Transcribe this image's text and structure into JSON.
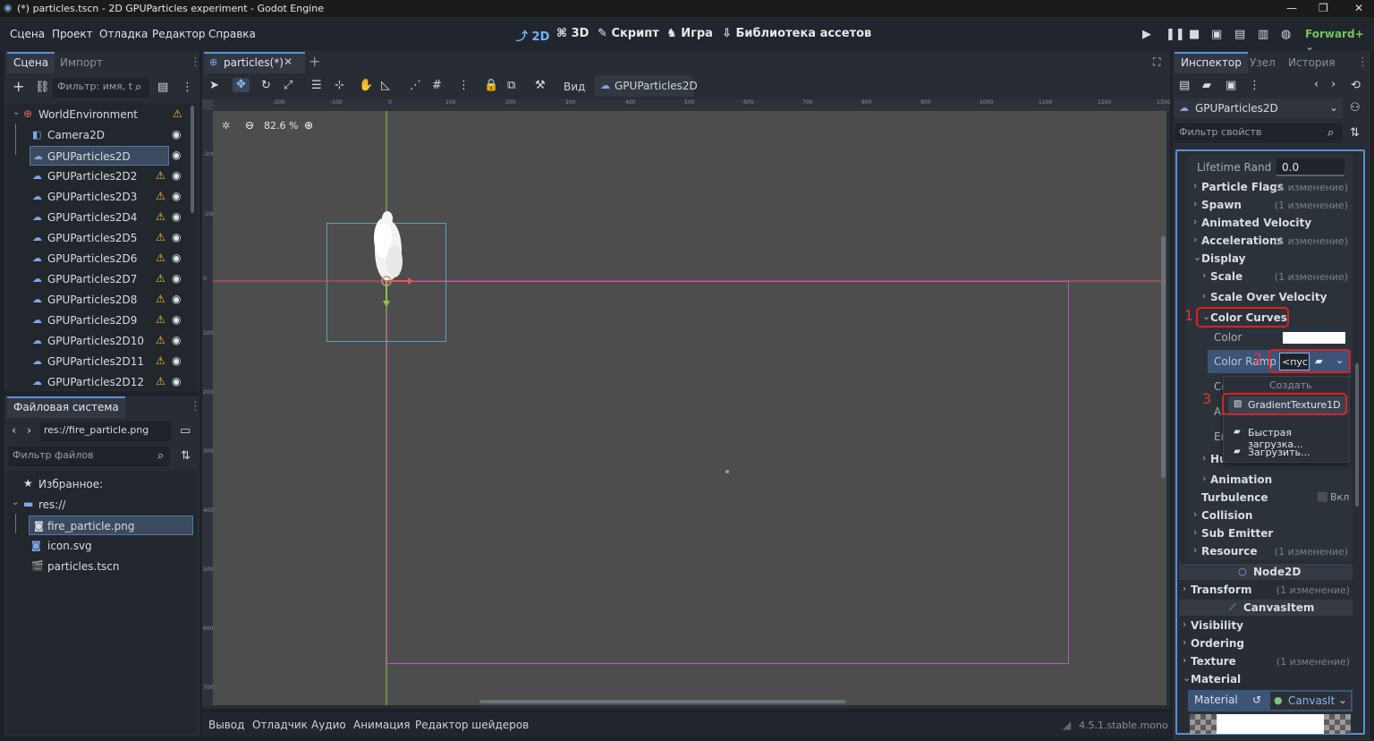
{
  "titlebar": {
    "title": "(*) particles.tscn - 2D GPUParticles experiment - Godot Engine"
  },
  "menu": [
    "Сцена",
    "Проект",
    "Отладка",
    "Редактор",
    "Справка"
  ],
  "workspaces": [
    "2D",
    "3D",
    "Скрипт",
    "Игра",
    "Библиотека ассетов"
  ],
  "renderer": "Forward+",
  "scene_panel": {
    "tabs": [
      "Сцена",
      "Импорт"
    ],
    "filter_placeholder": "Фильтр: имя, t",
    "root": "WorldEnvironment",
    "nodes": [
      "Camera2D",
      "GPUParticles2D",
      "GPUParticles2D2",
      "GPUParticles2D3",
      "GPUParticles2D4",
      "GPUParticles2D5",
      "GPUParticles2D6",
      "GPUParticles2D7",
      "GPUParticles2D8",
      "GPUParticles2D9",
      "GPUParticles2D10",
      "GPUParticles2D11",
      "GPUParticles2D12"
    ]
  },
  "filesystem": {
    "title": "Файловая система",
    "path": "res://fire_particle.png",
    "filter_placeholder": "Фильтр файлов",
    "favorites": "Избранное:",
    "root": "res://",
    "files": [
      "fire_particle.png",
      "icon.svg",
      "particles.tscn"
    ]
  },
  "editor": {
    "scene_tab": "particles(*)",
    "view_label": "Вид",
    "selected_node": "GPUParticles2D",
    "zoom": "82.6 %",
    "ruler": [
      "-200",
      "-100",
      "0",
      "100",
      "200",
      "300",
      "400",
      "500",
      "600",
      "700",
      "800",
      "900",
      "1000",
      "1100",
      "1200",
      "1300"
    ],
    "vruler": [
      "-200",
      "-100",
      "0",
      "100",
      "200",
      "300",
      "400",
      "500",
      "600",
      "700"
    ]
  },
  "bottom_tabs": [
    "Вывод",
    "Отладчик",
    "Аудио",
    "Анимация",
    "Редактор шейдеров"
  ],
  "version": "4.5.1.stable.mono",
  "inspector": {
    "tabs": [
      "Инспектор",
      "Узел",
      "История"
    ],
    "node": "GPUParticles2D",
    "filter_placeholder": "Фильтр свойств",
    "lifetime_label": "Lifetime Rand",
    "lifetime_value": "0.0",
    "change": "(1 изменение)",
    "props": [
      {
        "label": "Particle Flags",
        "changed": true
      },
      {
        "label": "Spawn",
        "changed": true
      },
      {
        "label": "Animated Velocity",
        "changed": false
      },
      {
        "label": "Accelerations",
        "changed": true
      },
      {
        "label": "Display",
        "changed": false
      }
    ],
    "scale": "Scale",
    "scale_over_velocity": "Scale Over Velocity",
    "color_curves": "Color Curves",
    "color": "Color",
    "color_ramp": "Color Ramp",
    "color_ramp_value": "<пус",
    "col_cut": "Col",
    "al_cut": "Al",
    "em_cut": "Em",
    "hue_cut": "Hue",
    "animation": "Animation",
    "turbulence": "Turbulence",
    "turbulence_value": "Вкл",
    "collision": "Collision",
    "sub_emitter": "Sub Emitter",
    "resource": "Resource",
    "node2d": "Node2D",
    "transform": "Transform",
    "canvasitem": "CanvasItem",
    "visibility": "Visibility",
    "ordering": "Ordering",
    "texture": "Texture",
    "material": "Material",
    "material_label": "Material",
    "material_value": "CanvasIt"
  },
  "dropdown": {
    "header": "Создать",
    "items": [
      "GradientTexture1D",
      "Быстрая загрузка...",
      "Загрузить..."
    ]
  },
  "annotations": [
    "1",
    "2",
    "3"
  ]
}
